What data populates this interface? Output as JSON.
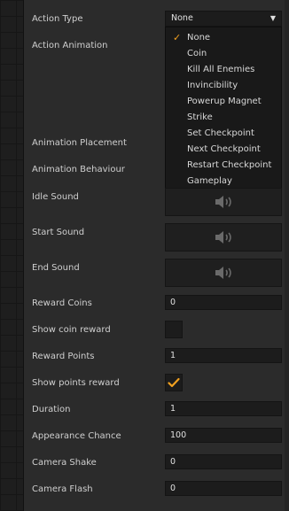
{
  "action_type": {
    "label": "Action Type",
    "selected": "None",
    "options": [
      "None",
      "Coin",
      "Kill All Enemies",
      "Invincibility",
      "Powerup Magnet",
      "Strike",
      "Set Checkpoint",
      "Next Checkpoint",
      "Restart Checkpoint",
      "Gameplay"
    ]
  },
  "labels": {
    "action_animation": "Action Animation",
    "animation_placement": "Animation Placement",
    "animation_behaviour": "Animation Behaviour",
    "idle_sound": "Idle Sound",
    "start_sound": "Start Sound",
    "end_sound": "End Sound",
    "reward_coins": "Reward Coins",
    "show_coin_reward": "Show coin reward",
    "reward_points": "Reward Points",
    "show_points_reward": "Show points reward",
    "duration": "Duration",
    "appearance_chance": "Appearance Chance",
    "camera_shake": "Camera Shake",
    "camera_flash": "Camera Flash"
  },
  "values": {
    "reward_coins": "0",
    "reward_points": "1",
    "duration": "1",
    "appearance_chance": "100",
    "camera_shake": "0",
    "camera_flash": "0"
  },
  "checkboxes": {
    "show_coin_reward": false,
    "show_points_reward": true
  },
  "icons": {
    "sound": "speaker-icon",
    "check": "checkmark-icon",
    "dropdown": "chevron-down-icon"
  },
  "colors": {
    "accent": "#f0a020",
    "background": "#2b2b2b",
    "field": "#1c1c1c"
  }
}
